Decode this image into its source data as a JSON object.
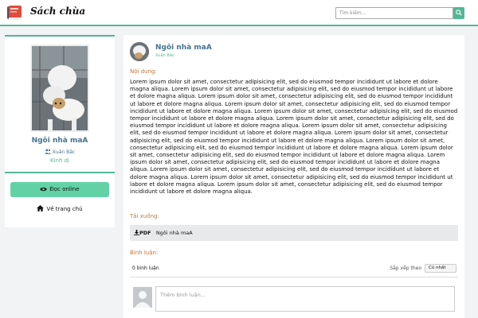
{
  "header": {
    "brand": "Sách chùa",
    "search_placeholder": "Tìm kiếm..."
  },
  "sidebar": {
    "book_title": "Ngôi nhà maA",
    "author": "Xuân Bắc",
    "genre": "Kinh dị",
    "read_button": "Đọc online",
    "home_link": "Về trang chủ"
  },
  "main": {
    "title": "Ngôi nhà maA",
    "author": "Xuân Bắc",
    "content_label": "Nội dung:",
    "content_text": "Lorem ipsum dolor sit amet, consectetur adipisicing elit, sed do eiusmod tempor incididunt ut labore et dolore magna aliqua. Lorem ipsum dolor sit amet, consectetur adipisicing elit, sed do eiusmod tempor incididunt ut labore et dolore magna aliqua. Lorem ipsum dolor sit amet, consectetur adipisicing elit, sed do eiusmod tempor incididunt ut labore et dolore magna aliqua. Lorem ipsum dolor sit amet, consectetur adipisicing elit, sed do eiusmod tempor incididunt ut labore et dolore magna aliqua. Lorem ipsum dolor sit amet, consectetur adipisicing elit, sed do eiusmod tempor incididunt ut labore et dolore magna aliqua. Lorem ipsum dolor sit amet, consectetur adipisicing elit, sed do eiusmod tempor incididunt ut labore et dolore magna aliqua. Lorem ipsum dolor sit amet, consectetur adipisicing elit, sed do eiusmod tempor incididunt ut labore et dolore magna aliqua. Lorem ipsum dolor sit amet, consectetur adipisicing elit, sed do eiusmod tempor incididunt ut labore et dolore magna aliqua. Lorem ipsum dolor sit amet, consectetur adipisicing elit, sed do eiusmod tempor incididunt ut labore et dolore magna aliqua. Lorem ipsum dolor sit amet, consectetur adipisicing elit, sed do eiusmod tempor incididunt ut labore et dolore magna aliqua. Lorem ipsum dolor sit amet, consectetur adipisicing elit, sed do eiusmod tempor incididunt ut labore et dolore magna aliqua. Lorem ipsum dolor sit amet, consectetur adipisicing elit, sed do eiusmod tempor incididunt ut labore et dolore magna aliqua. Lorem ipsum dolor sit amet, consectetur adipisicing elit, sed do eiusmod tempor incididunt ut labore et dolore magna aliqua. Lorem ipsum dolor sit amet, consectetur adipisicing elit, sed do eiusmod tempor incididunt ut labore et dolore magna aliqua.",
    "download_label": "Tải xuống:",
    "download_pdf": "PDF",
    "download_name": "Ngôi nhà maA",
    "comments_label": "Bình luận:",
    "comment_count": "0 bình luận",
    "sort_label": "Sắp xếp theo",
    "sort_value": "Cũ nhất",
    "comment_placeholder": "Thêm bình luận..."
  },
  "colors": {
    "accent": "#52b795",
    "button": "#62d2a6",
    "link_blue": "#46738f",
    "section_label": "#c0763a"
  },
  "icons": [
    "book-logo-icon",
    "search-icon",
    "user-icon",
    "eye-icon",
    "home-icon",
    "download-icon"
  ]
}
